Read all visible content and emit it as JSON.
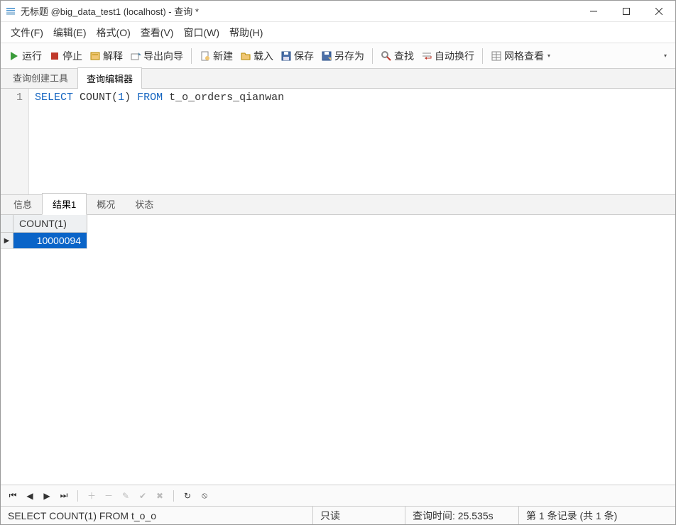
{
  "window": {
    "title": "无标题 @big_data_test1 (localhost) - 查询 *"
  },
  "menu": {
    "file": "文件(F)",
    "edit": "编辑(E)",
    "format": "格式(O)",
    "view": "查看(V)",
    "window": "窗口(W)",
    "help": "帮助(H)"
  },
  "toolbar": {
    "run": "运行",
    "stop": "停止",
    "explain": "解释",
    "export": "导出向导",
    "new": "新建",
    "load": "载入",
    "save": "保存",
    "save_as": "另存为",
    "find": "查找",
    "autowrap": "自动换行",
    "gridview": "网格查看"
  },
  "editor_tabs": {
    "builder": "查询创建工具",
    "editor": "查询编辑器"
  },
  "code": {
    "line_no": "1",
    "sql_select": "SELECT",
    "sql_count": "COUNT",
    "sql_open": "(",
    "sql_arg": "1",
    "sql_close": ")",
    "sql_from": "FROM",
    "sql_table": "t_o_orders_qianwan"
  },
  "result_tabs": {
    "info": "信息",
    "result1": "结果1",
    "profile": "概况",
    "status": "状态"
  },
  "grid": {
    "column": "COUNT(1)",
    "row_marker": "▶",
    "value": "10000094"
  },
  "status": {
    "sql": "SELECT COUNT(1) FROM t_o_o",
    "readonly": "只读",
    "timing": "查询时间: 25.535s",
    "records": "第 1 条记录 (共 1 条)"
  }
}
